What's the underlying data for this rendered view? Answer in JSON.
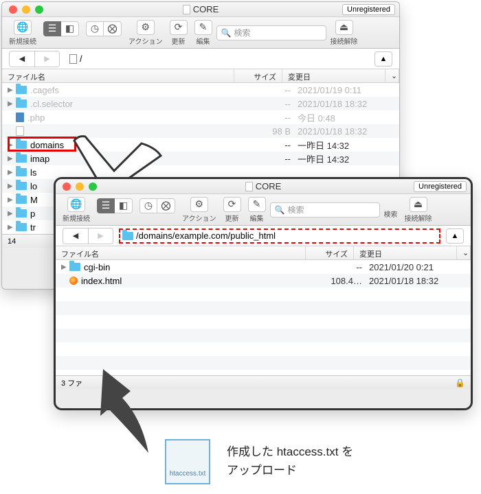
{
  "app_title": "CORE",
  "unregistered": "Unregistered",
  "toolbar": {
    "new_connection": "新規接続",
    "action": "アクション",
    "refresh": "更新",
    "edit": "編集",
    "search": "検索",
    "disconnect": "接続解除",
    "search_placeholder": "検索"
  },
  "cols": {
    "name": "ファイル名",
    "size": "サイズ",
    "date": "変更日"
  },
  "back": {
    "path": "/",
    "files": [
      {
        "name": ".cagefs",
        "kind": "folder",
        "size": "--",
        "date": "2021/01/19 0:11",
        "dim": true
      },
      {
        "name": ".cl.selector",
        "kind": "folder",
        "size": "--",
        "date": "2021/01/18 18:32",
        "dim": true
      },
      {
        "name": ".php",
        "kind": "php",
        "size": "--",
        "date": "今日 0:48",
        "dim": true
      },
      {
        "name": "",
        "kind": "file",
        "size": "98 B",
        "date": "2021/01/18 18:32",
        "dim": true
      },
      {
        "name": "domains",
        "kind": "folder",
        "size": "--",
        "date": "一昨日 14:32",
        "dim": false
      },
      {
        "name": "imap",
        "kind": "folder",
        "size": "--",
        "date": "一昨日 14:32",
        "dim": false
      },
      {
        "name": "ls",
        "kind": "folder",
        "size": "",
        "date": "",
        "dim": false
      },
      {
        "name": "lo",
        "kind": "folder",
        "size": "",
        "date": "",
        "dim": false
      },
      {
        "name": "M",
        "kind": "folder",
        "size": "",
        "date": "",
        "dim": false
      },
      {
        "name": "p",
        "kind": "folder",
        "size": "",
        "date": "",
        "dim": false
      },
      {
        "name": "tr",
        "kind": "folder",
        "size": "",
        "date": "",
        "dim": false
      }
    ],
    "status": "14"
  },
  "front": {
    "path": "/domains/example.com/public_html",
    "files": [
      {
        "name": "cgi-bin",
        "kind": "folder",
        "size": "--",
        "date": "2021/01/20 0:21"
      },
      {
        "name": "index.html",
        "kind": "ff",
        "size": "108.4…",
        "date": "2021/01/18 18:32"
      }
    ],
    "status": "3 ファ"
  },
  "thumb_label": "htaccess.txt",
  "caption_l1": "作成した htaccess.txt を",
  "caption_l2": "アップロード"
}
